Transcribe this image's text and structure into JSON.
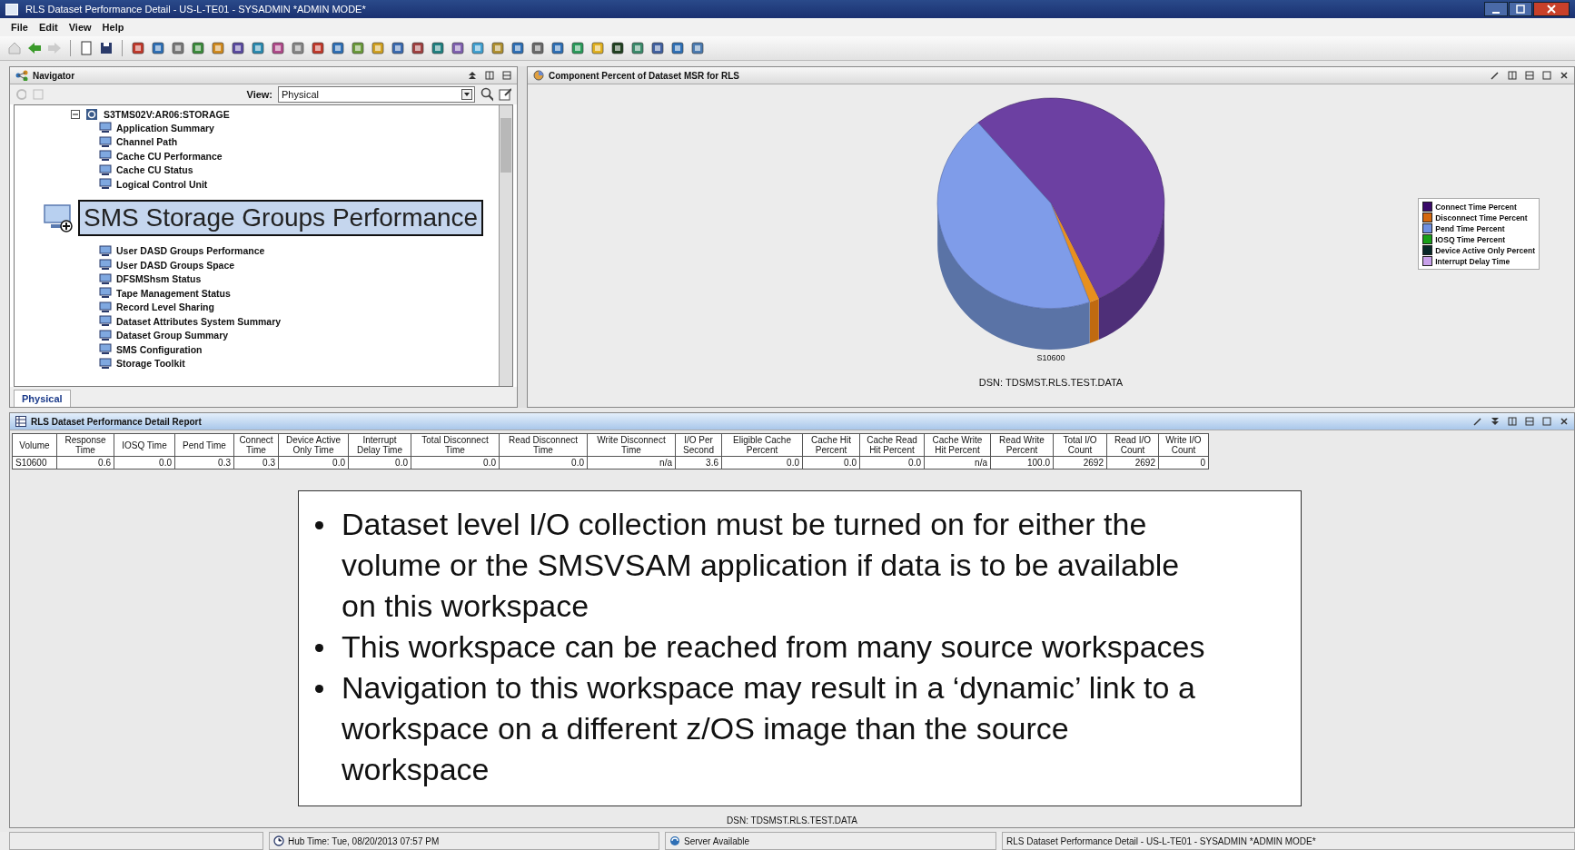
{
  "window": {
    "title": "RLS Dataset Performance Detail - US-L-TE01 - SYSADMIN   *ADMIN MODE*"
  },
  "menu": [
    "File",
    "Edit",
    "View",
    "Help"
  ],
  "navigator": {
    "title": "Navigator",
    "view_label": "View:",
    "view_value": "Physical",
    "tree": {
      "label": "S3TMS02V:AR06:STORAGE",
      "expanded": true,
      "children": [
        {
          "label": "Application Summary",
          "kind": "item"
        },
        {
          "label": "Channel Path",
          "kind": "item"
        },
        {
          "label": "Cache CU Performance",
          "kind": "item"
        },
        {
          "label": "Cache CU Status",
          "kind": "item"
        },
        {
          "label": "Logical Control Unit",
          "kind": "item"
        },
        {
          "label": "SMS Storage Groups Performance",
          "kind": "magnified"
        },
        {
          "label": "User DASD Groups Performance",
          "kind": "item"
        },
        {
          "label": "User DASD Groups Space",
          "kind": "item"
        },
        {
          "label": "DFSMShsm Status",
          "kind": "item"
        },
        {
          "label": "Tape Management Status",
          "kind": "item"
        },
        {
          "label": "Record Level Sharing",
          "kind": "item"
        },
        {
          "label": "Dataset Attributes System Summary",
          "kind": "item"
        },
        {
          "label": "Dataset Group Summary",
          "kind": "item"
        },
        {
          "label": "SMS Configuration",
          "kind": "item"
        },
        {
          "label": "Storage Toolkit",
          "kind": "item"
        }
      ]
    },
    "tabs": [
      {
        "label": "Physical",
        "selected": true
      }
    ]
  },
  "chart_panel": {
    "title": "Component Percent of Dataset MSR for RLS",
    "pie_label": "S10600",
    "caption": "DSN:  TDSMST.RLS.TEST.DATA",
    "legend": [
      {
        "label": "Connect Time Percent",
        "color": "#3a0a6a"
      },
      {
        "label": "Disconnect Time Percent",
        "color": "#d4680e"
      },
      {
        "label": "Pend Time Percent",
        "color": "#7090e0"
      },
      {
        "label": "IOSQ Time Percent",
        "color": "#18a018"
      },
      {
        "label": "Device Active Only Percent",
        "color": "#082828"
      },
      {
        "label": "Interrupt Delay Time",
        "color": "#c8a0ea"
      }
    ]
  },
  "report": {
    "title": "RLS Dataset Performance Detail Report",
    "columns": [
      "Volume",
      "Response Time",
      "IOSQ Time",
      "Pend Time",
      "Connect Time",
      "Device Active Only Time",
      "Interrupt Delay Time",
      "Total Disconnect Time",
      "Read Disconnect Time",
      "Write Disconnect Time",
      "I/O Per Second",
      "Eligible Cache Percent",
      "Cache Hit Percent",
      "Cache Read Hit Percent",
      "Cache Write Hit Percent",
      "Read Write Percent",
      "Total I/O Count",
      "Read I/O Count",
      "Write I/O Count"
    ],
    "rows": [
      [
        "S10600",
        "0.6",
        "0.0",
        "0.3",
        "0.3",
        "0.0",
        "0.0",
        "0.0",
        "0.0",
        "n/a",
        "3.6",
        "0.0",
        "0.0",
        "0.0",
        "n/a",
        "100.0",
        "2692",
        "2692",
        "0"
      ]
    ],
    "footer": "DSN:  TDSMST.RLS.TEST.DATA"
  },
  "callout": [
    "Dataset level I/O collection must be turned on for either the volume or the SMSVSAM application if data is to be available on this workspace",
    "This workspace can be reached from many source workspaces",
    "Navigation to this workspace may result in a ‘dynamic’ link to a workspace on a different z/OS image than the source workspace"
  ],
  "status_bar": {
    "hub_time": "Hub Time: Tue, 08/20/2013 07:57 PM",
    "server": "Server Available",
    "title": "RLS Dataset Performance Detail - US-L-TE01 - SYSADMIN   *ADMIN MODE*"
  }
}
